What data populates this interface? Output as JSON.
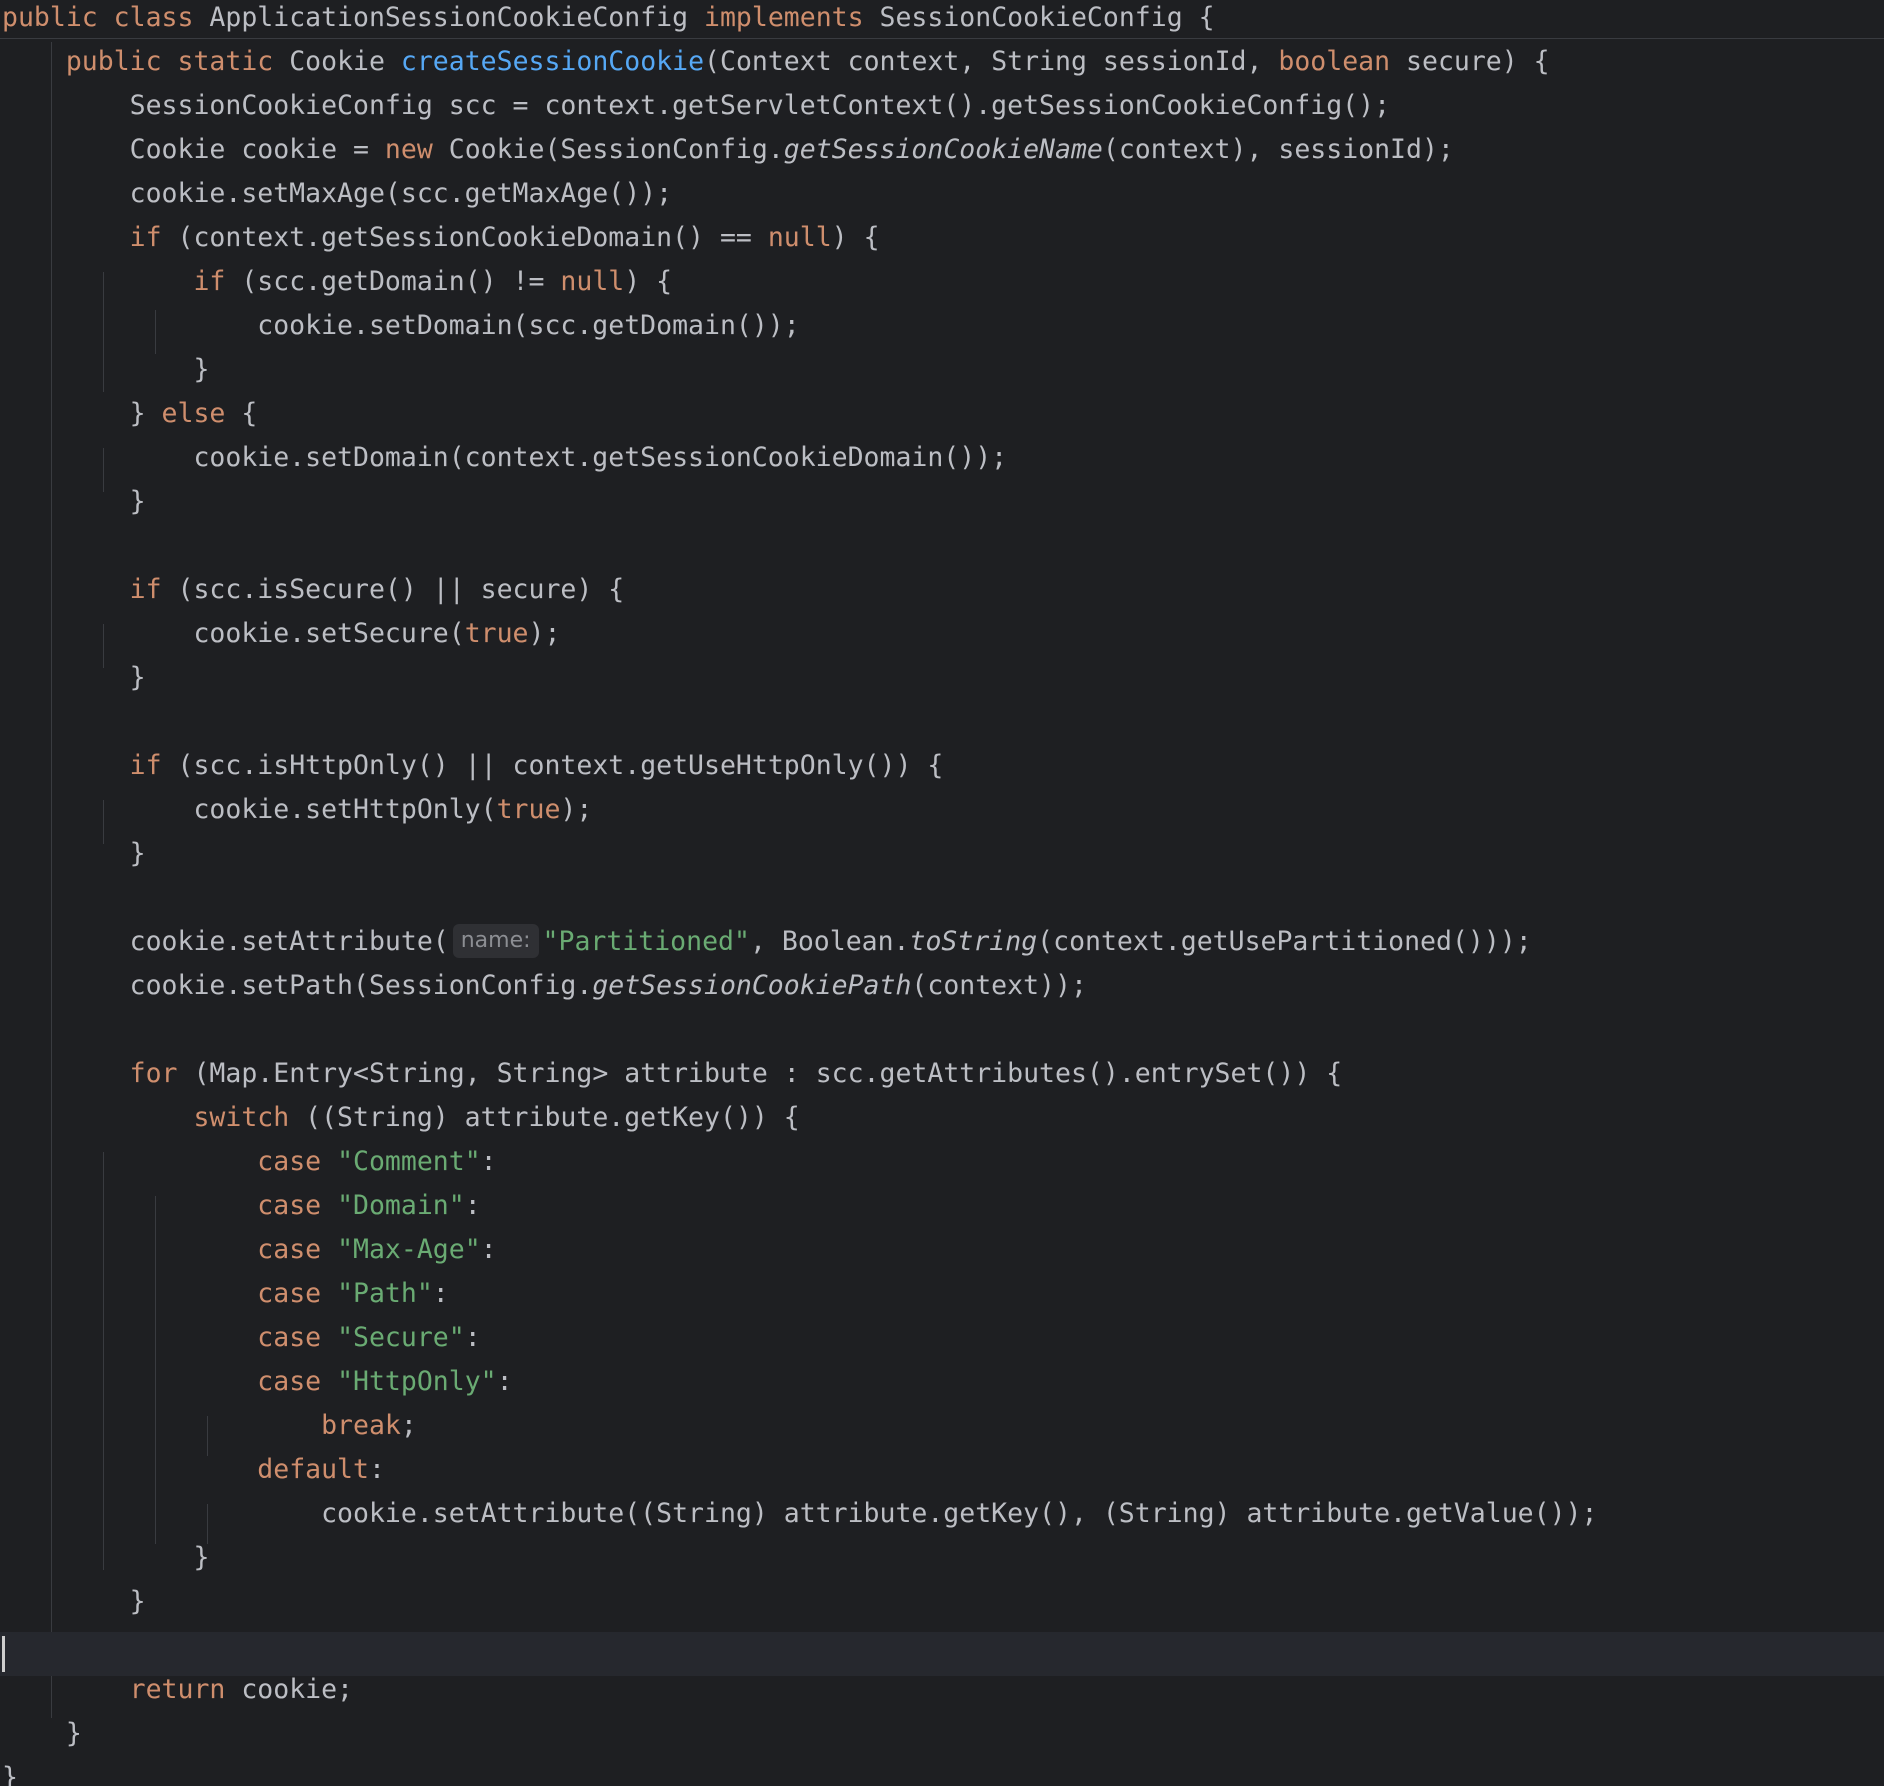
{
  "editor": {
    "lines": [
      [
        {
          "t": "public class ",
          "k": "kw"
        },
        {
          "t": "ApplicationSessionCookieConfig "
        },
        {
          "t": "implements ",
          "k": "kw"
        },
        {
          "t": "SessionCookieConfig {"
        }
      ],
      [
        {
          "t": "    "
        },
        {
          "t": "public static ",
          "k": "kw"
        },
        {
          "t": "Cookie "
        },
        {
          "t": "createSessionCookie",
          "k": "fn"
        },
        {
          "t": "(Context context, String sessionId, "
        },
        {
          "t": "boolean ",
          "k": "kw"
        },
        {
          "t": "secure) {"
        }
      ],
      [
        {
          "t": "        SessionCookieConfig scc = context.getServletContext().getSessionCookieConfig();"
        }
      ],
      [
        {
          "t": "        Cookie cookie = "
        },
        {
          "t": "new ",
          "k": "kw"
        },
        {
          "t": "Cookie(SessionConfig."
        },
        {
          "t": "getSessionCookieName",
          "k": "it"
        },
        {
          "t": "(context), sessionId);"
        }
      ],
      [
        {
          "t": "        cookie.setMaxAge(scc.getMaxAge());"
        }
      ],
      [
        {
          "t": "        "
        },
        {
          "t": "if ",
          "k": "kw"
        },
        {
          "t": "(context.getSessionCookieDomain() == "
        },
        {
          "t": "null",
          "k": "kw"
        },
        {
          "t": ") {"
        }
      ],
      [
        {
          "t": "            "
        },
        {
          "t": "if ",
          "k": "kw"
        },
        {
          "t": "(scc.getDomain() != "
        },
        {
          "t": "null",
          "k": "kw"
        },
        {
          "t": ") {"
        }
      ],
      [
        {
          "t": "                cookie.setDomain(scc.getDomain());"
        }
      ],
      [
        {
          "t": "            }"
        }
      ],
      [
        {
          "t": "        } "
        },
        {
          "t": "else ",
          "k": "kw"
        },
        {
          "t": "{"
        }
      ],
      [
        {
          "t": "            cookie.setDomain(context.getSessionCookieDomain());"
        }
      ],
      [
        {
          "t": "        }"
        }
      ],
      [],
      [
        {
          "t": "        "
        },
        {
          "t": "if ",
          "k": "kw"
        },
        {
          "t": "(scc.isSecure() || secure) {"
        }
      ],
      [
        {
          "t": "            cookie.setSecure("
        },
        {
          "t": "true",
          "k": "kw"
        },
        {
          "t": ");"
        }
      ],
      [
        {
          "t": "        }"
        }
      ],
      [],
      [
        {
          "t": "        "
        },
        {
          "t": "if ",
          "k": "kw"
        },
        {
          "t": "(scc.isHttpOnly() || context.getUseHttpOnly()) {"
        }
      ],
      [
        {
          "t": "            cookie.setHttpOnly("
        },
        {
          "t": "true",
          "k": "kw"
        },
        {
          "t": ");"
        }
      ],
      [
        {
          "t": "        }"
        }
      ],
      [],
      [
        {
          "t": "        cookie.setAttribute("
        },
        {
          "t": "name:",
          "k": "hint"
        },
        {
          "t": "\"Partitioned\"",
          "k": "str"
        },
        {
          "t": ", Boolean."
        },
        {
          "t": "toString",
          "k": "it"
        },
        {
          "t": "(context.getUsePartitioned()));"
        }
      ],
      [
        {
          "t": "        cookie.setPath(SessionConfig."
        },
        {
          "t": "getSessionCookiePath",
          "k": "it"
        },
        {
          "t": "(context));"
        }
      ],
      [],
      [
        {
          "t": "        "
        },
        {
          "t": "for ",
          "k": "kw"
        },
        {
          "t": "(Map.Entry<String, String> attribute : scc.getAttributes().entrySet()) {"
        }
      ],
      [
        {
          "t": "            "
        },
        {
          "t": "switch ",
          "k": "kw"
        },
        {
          "t": "((String) attribute.getKey()) {"
        }
      ],
      [
        {
          "t": "                "
        },
        {
          "t": "case ",
          "k": "kw"
        },
        {
          "t": "\"Comment\"",
          "k": "str"
        },
        {
          "t": ":"
        }
      ],
      [
        {
          "t": "                "
        },
        {
          "t": "case ",
          "k": "kw"
        },
        {
          "t": "\"Domain\"",
          "k": "str"
        },
        {
          "t": ":"
        }
      ],
      [
        {
          "t": "                "
        },
        {
          "t": "case ",
          "k": "kw"
        },
        {
          "t": "\"Max-Age\"",
          "k": "str"
        },
        {
          "t": ":"
        }
      ],
      [
        {
          "t": "                "
        },
        {
          "t": "case ",
          "k": "kw"
        },
        {
          "t": "\"Path\"",
          "k": "str"
        },
        {
          "t": ":"
        }
      ],
      [
        {
          "t": "                "
        },
        {
          "t": "case ",
          "k": "kw"
        },
        {
          "t": "\"Secure\"",
          "k": "str"
        },
        {
          "t": ":"
        }
      ],
      [
        {
          "t": "                "
        },
        {
          "t": "case ",
          "k": "kw"
        },
        {
          "t": "\"HttpOnly\"",
          "k": "str"
        },
        {
          "t": ":"
        }
      ],
      [
        {
          "t": "                    "
        },
        {
          "t": "break",
          "k": "kw"
        },
        {
          "t": ";"
        }
      ],
      [
        {
          "t": "                "
        },
        {
          "t": "default",
          "k": "kw"
        },
        {
          "t": ":"
        }
      ],
      [
        {
          "t": "                    cookie.setAttribute((String) attribute.getKey(), (String) attribute.getValue());"
        }
      ],
      [
        {
          "t": "            }"
        }
      ],
      [
        {
          "t": "        }"
        }
      ],
      [],
      [
        {
          "t": "        "
        },
        {
          "t": "return ",
          "k": "kw"
        },
        {
          "t": "cookie;"
        }
      ],
      [
        {
          "t": "    }"
        }
      ],
      [
        {
          "t": "}"
        }
      ]
    ]
  },
  "colors": {
    "background": "#1e1f22",
    "text": "#bcbec4",
    "keyword": "#cf8e6d",
    "string": "#6aab73",
    "method_declaration": "#56a8f5",
    "current_line": "#26282e"
  }
}
